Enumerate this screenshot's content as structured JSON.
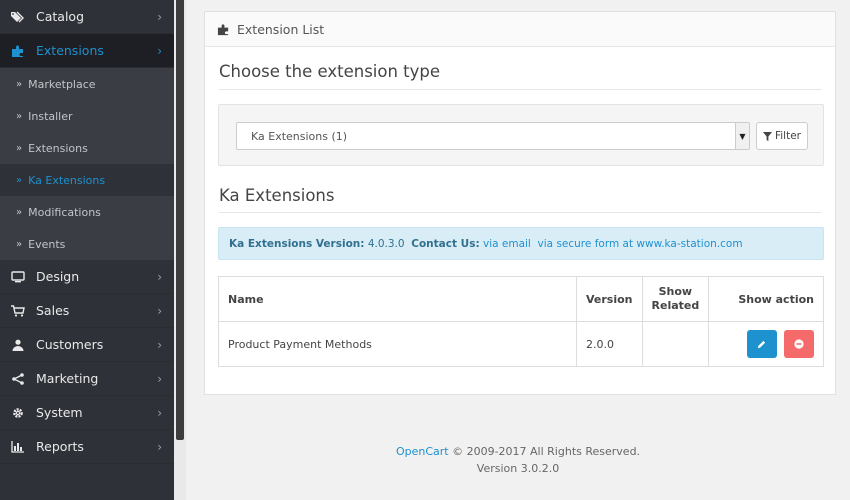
{
  "sidebar": {
    "catalog": "Catalog",
    "extensions": "Extensions",
    "sub_items": [
      "Marketplace",
      "Installer",
      "Extensions",
      "Ka Extensions",
      "Modifications",
      "Events"
    ],
    "design": "Design",
    "sales": "Sales",
    "customers": "Customers",
    "marketing": "Marketing",
    "system": "System",
    "reports": "Reports"
  },
  "panel": {
    "heading": "Extension List",
    "choose_title": "Choose the extension type",
    "select_value": "Ka Extensions (1)",
    "filter_label": "Filter",
    "section_title": "Ka Extensions"
  },
  "alert": {
    "version_label": "Ka Extensions Version:",
    "version_value": "4.0.3.0",
    "contact_label": "Contact Us:",
    "link_email": "via email",
    "link_form": "via secure form at www.ka-station.com"
  },
  "table": {
    "headers": {
      "name": "Name",
      "version": "Version",
      "show_related_1": "Show",
      "show_related_2": "Related",
      "action": "Show action"
    },
    "rows": [
      {
        "name": "Product Payment Methods",
        "version": "2.0.0",
        "related": ""
      }
    ]
  },
  "footer": {
    "brand": "OpenCart",
    "copyright": "© 2009-2017 All Rights Reserved.",
    "version": "Version 3.0.2.0"
  },
  "colors": {
    "sidebar_bg": "#2e3137",
    "accent": "#1e91cf",
    "danger": "#f56b6b",
    "alert_bg": "#d9edf7"
  }
}
